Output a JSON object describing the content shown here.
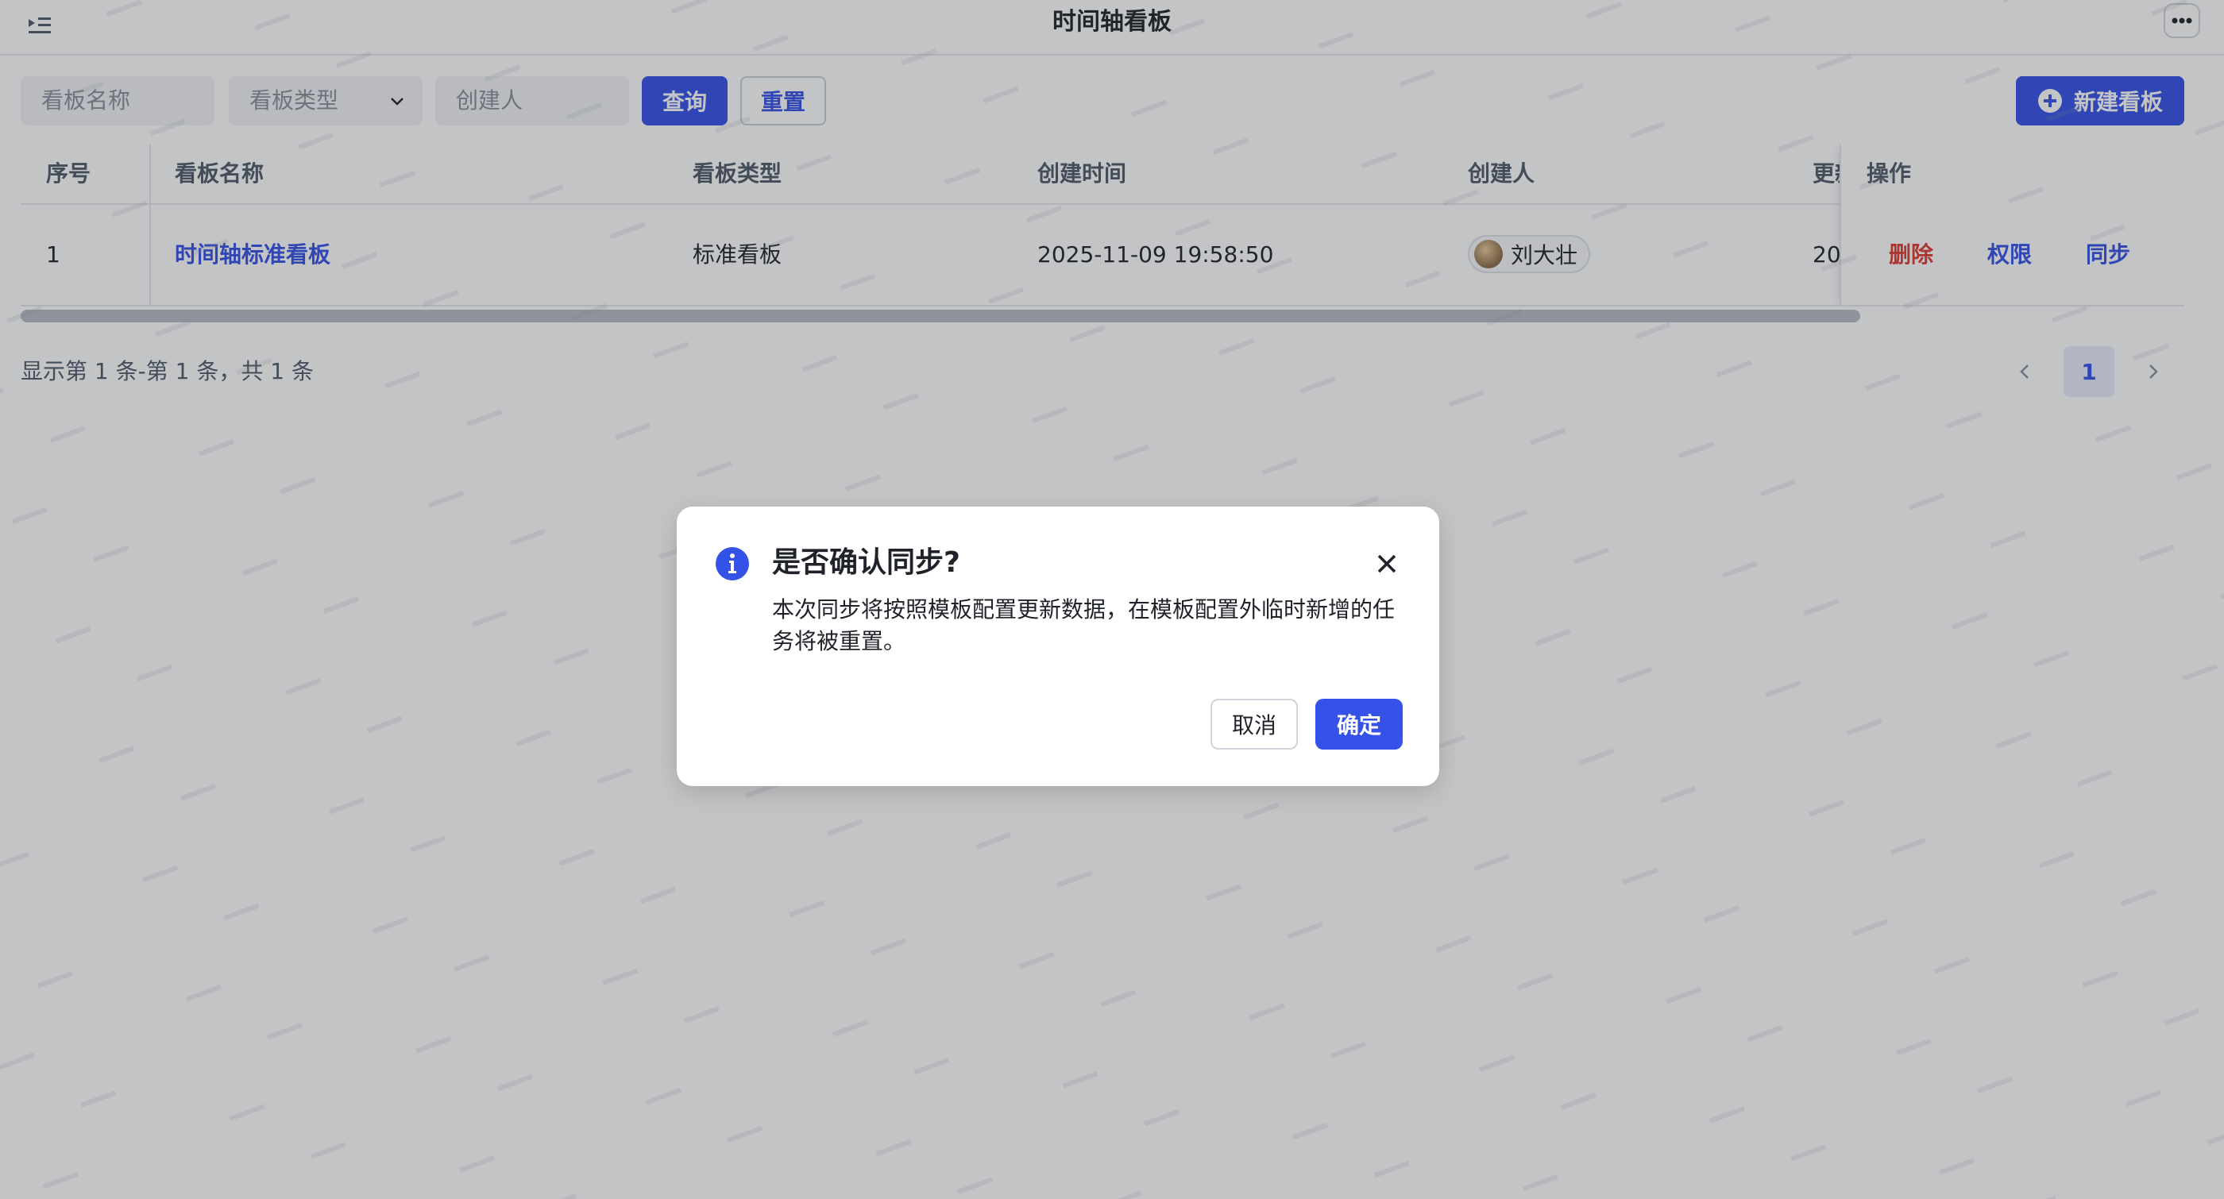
{
  "header": {
    "title": "时间轴看板"
  },
  "filters": {
    "name_placeholder": "看板名称",
    "type_placeholder": "看板类型",
    "creator_placeholder": "创建人",
    "query_label": "查询",
    "reset_label": "重置",
    "new_board_label": "新建看板"
  },
  "table": {
    "columns": [
      "序号",
      "看板名称",
      "看板类型",
      "创建时间",
      "创建人",
      "更新",
      "操作"
    ],
    "rows": [
      {
        "index": "1",
        "name": "时间轴标准看板",
        "type": "标准看板",
        "created_at": "2025-11-09 19:58:50",
        "creator": "刘大壮",
        "updated_at": "20",
        "actions": {
          "delete": "删除",
          "permission": "权限",
          "sync": "同步"
        }
      }
    ]
  },
  "pagination": {
    "summary": "显示第 1 条-第 1 条，共 1 条",
    "current_page": "1"
  },
  "dialog": {
    "title": "是否确认同步?",
    "body": "本次同步将按照模板配置更新数据，在模板配置外临时新增的任务将被重置。",
    "cancel_label": "取消",
    "confirm_label": "确定"
  },
  "colors": {
    "primary": "#3451e8",
    "danger": "#e03a2f"
  }
}
